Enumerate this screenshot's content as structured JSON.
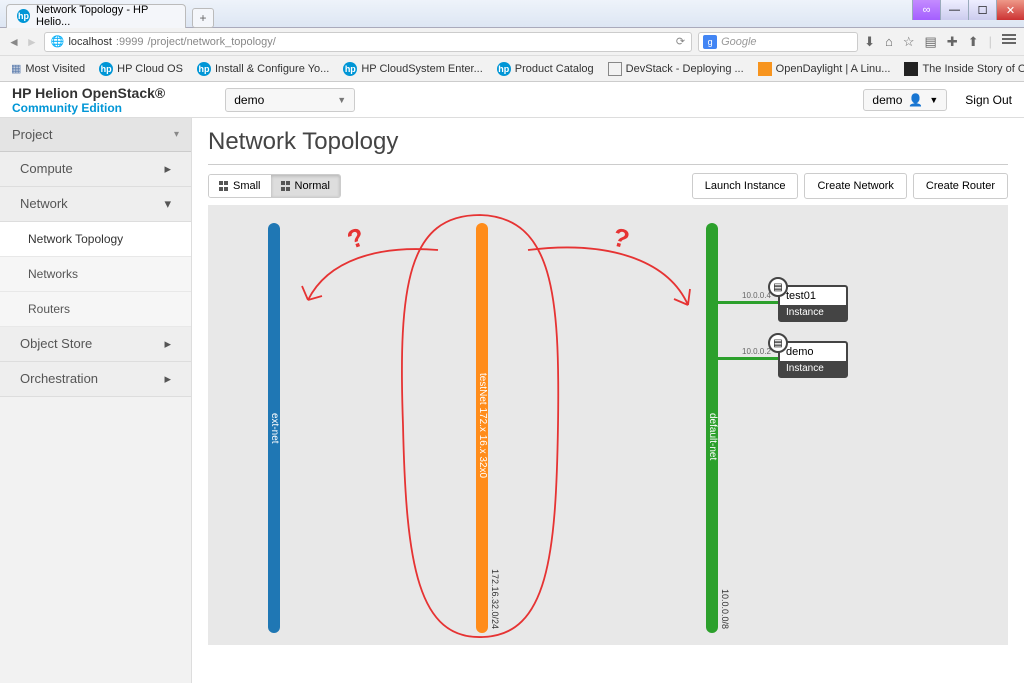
{
  "window": {
    "tab_title": "Network Topology - HP Helio...",
    "url_host": "localhost",
    "url_port": ":9999",
    "url_path": "/project/network_topology/",
    "search_hint": "Google"
  },
  "bookmarks": [
    "Most Visited",
    "HP Cloud OS",
    "Install & Configure Yo...",
    "HP CloudSystem Enter...",
    "Product Catalog",
    "DevStack - Deploying ...",
    "OpenDaylight | A Linu...",
    "The Inside Story of Oc..."
  ],
  "brand": {
    "line1": "HP Helion OpenStack®",
    "line2": "Community Edition"
  },
  "header": {
    "tenant": "demo",
    "user": "demo",
    "signout": "Sign Out"
  },
  "sidebar": {
    "project": "Project",
    "compute": "Compute",
    "network": "Network",
    "items": [
      "Network Topology",
      "Networks",
      "Routers"
    ],
    "object_store": "Object Store",
    "orchestration": "Orchestration"
  },
  "page": {
    "title": "Network Topology"
  },
  "toolbar": {
    "small": "Small",
    "normal": "Normal",
    "launch": "Launch Instance",
    "create_net": "Create Network",
    "create_router": "Create Router"
  },
  "networks": {
    "ext": {
      "name": "ext-net"
    },
    "test": {
      "name": "testNet 172.x 16.x 32x0",
      "cidr": "172.16.32.0/24"
    },
    "default": {
      "name": "default-net",
      "cidr": "10.0.0.0/8"
    }
  },
  "instances": [
    {
      "name": "test01",
      "type": "Instance",
      "ip": "10.0.0.4"
    },
    {
      "name": "demo",
      "type": "Instance",
      "ip": "10.0.0.2"
    }
  ],
  "annotations": {
    "q1": "?",
    "q2": "?"
  }
}
